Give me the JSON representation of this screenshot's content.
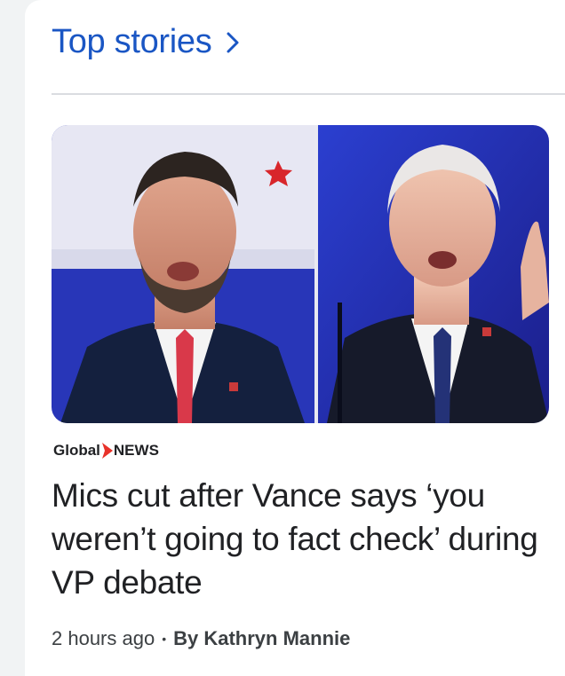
{
  "section": {
    "title": "Top stories"
  },
  "story": {
    "source_part1": "Global",
    "source_part2": "NEWS",
    "headline": "Mics cut after Vance says ‘you weren’t going to fact check’ during VP debate",
    "time": "2 hours ago",
    "separator": "•",
    "author": "By Kathryn Mannie"
  },
  "colors": {
    "link": "#1a56c4",
    "source_arrow": "#e8322a",
    "text": "#202124"
  },
  "icons": {
    "header_chevron": "chevron-right-icon",
    "source_mark": "arrow-right-icon"
  }
}
